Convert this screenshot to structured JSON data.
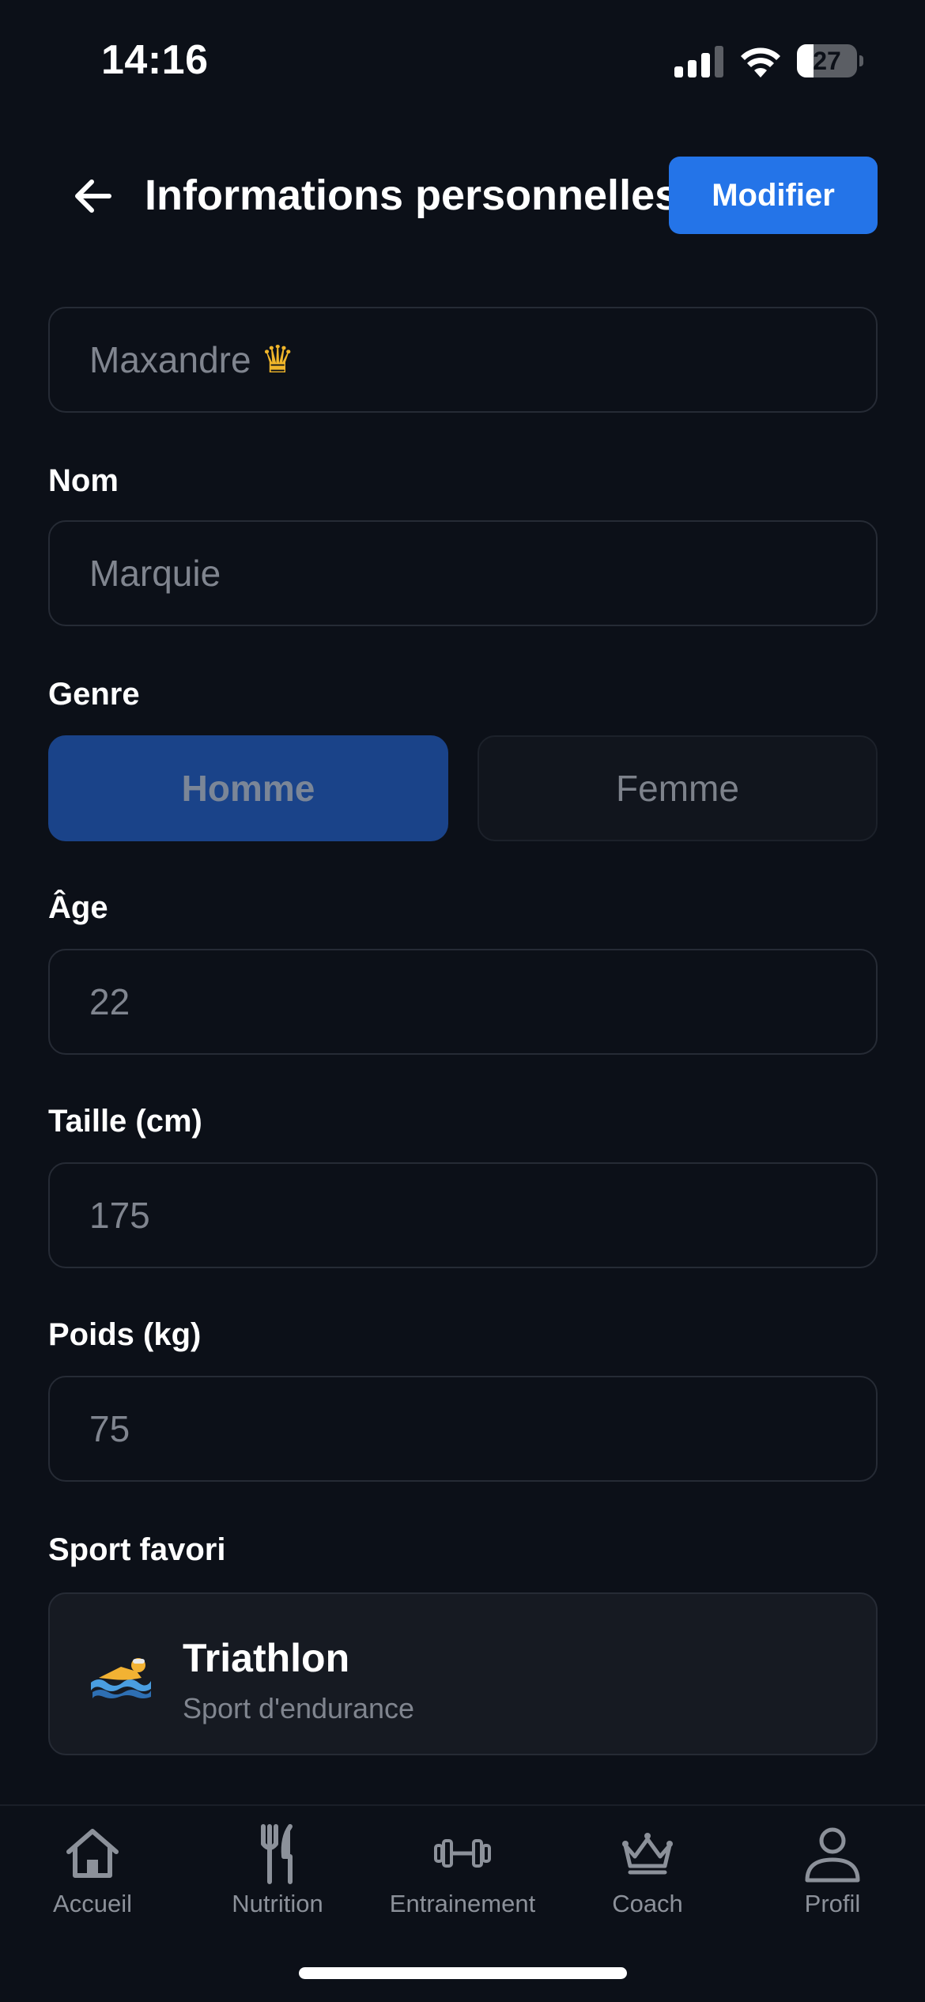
{
  "status_bar": {
    "time": "14:16",
    "battery_level": "27",
    "battery_fraction": 0.27
  },
  "header": {
    "title": "Informations personnelles",
    "edit_button": "Modifier",
    "back_icon": "arrow-left-icon"
  },
  "form": {
    "first_name": {
      "value": "Maxandre",
      "emoji_icon": "crown-icon"
    },
    "last_name": {
      "label": "Nom",
      "value": "Marquie"
    },
    "gender": {
      "label": "Genre",
      "options": [
        "Homme",
        "Femme"
      ],
      "selected": "Homme"
    },
    "age": {
      "label": "Âge",
      "value": "22"
    },
    "height": {
      "label": "Taille (cm)",
      "value": "175"
    },
    "weight": {
      "label": "Poids (kg)",
      "value": "75"
    },
    "favorite_sport": {
      "label": "Sport favori",
      "name": "Triathlon",
      "description": "Sport d'endurance",
      "icon": "swimmer-icon"
    }
  },
  "tab_bar": {
    "items": [
      {
        "label": "Accueil",
        "icon": "home-icon"
      },
      {
        "label": "Nutrition",
        "icon": "fork-knife-icon"
      },
      {
        "label": "Entrainement",
        "icon": "dumbbell-icon"
      },
      {
        "label": "Coach",
        "icon": "crown-icon"
      },
      {
        "label": "Profil",
        "icon": "person-icon"
      }
    ]
  },
  "colors": {
    "background": "#0c1018",
    "accent": "#2474e8",
    "selected_option": "#1a4389"
  }
}
